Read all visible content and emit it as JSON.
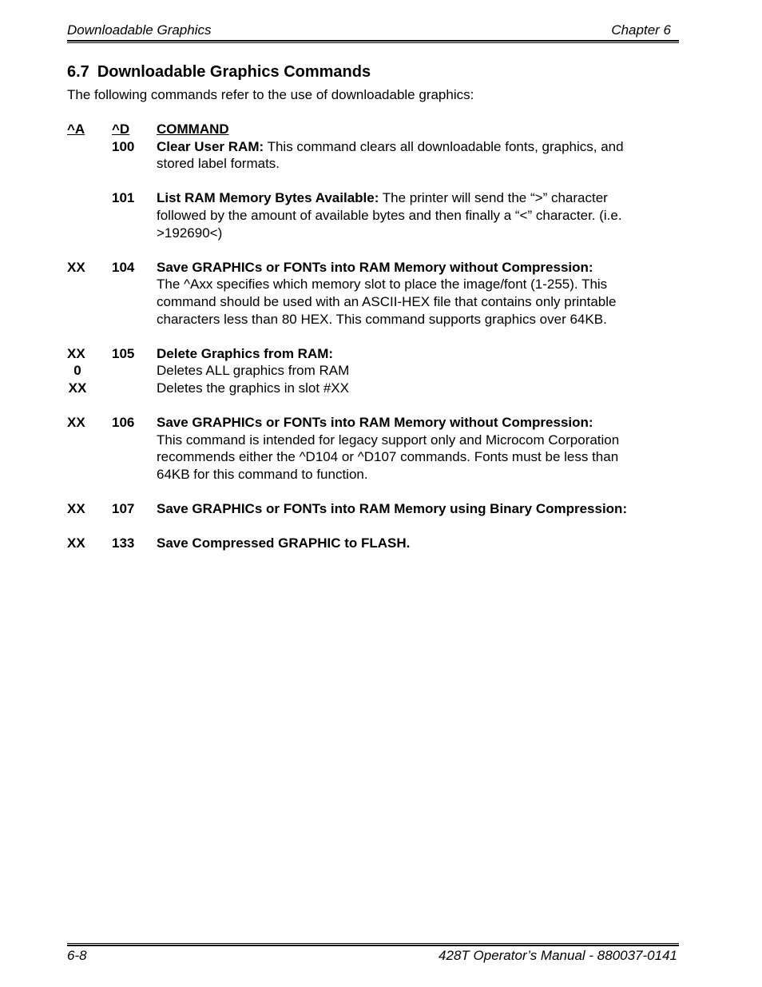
{
  "header": {
    "left": "Downloadable Graphics",
    "right": "Chapter 6"
  },
  "section": {
    "number": "6.7",
    "title": "Downloadable Graphics Commands",
    "intro": "The following commands refer to the use of downloadable graphics:"
  },
  "table": {
    "headers": {
      "a": "^A",
      "d": "^D",
      "command": "COMMAND"
    },
    "entries": [
      {
        "a": "",
        "d": "100",
        "title": "Clear User RAM:",
        "text": " This command clears all downloadable fonts, graphics, and",
        "lines": [
          "stored label formats."
        ]
      },
      {
        "a": "",
        "d": "101",
        "title": "List RAM Memory Bytes Available:",
        "text": " The printer will send the “>” character",
        "lines": [
          "followed by the amount of available bytes and then finally a “<” character.  (i.e.",
          ">192690<)"
        ]
      },
      {
        "a": "XX",
        "d": "104",
        "title": "Save GRAPHICs or FONTs  into RAM Memory without Compression:",
        "text": "",
        "lines": [
          "The ^Axx specifies which memory slot to place the image/font (1-255).  This",
          "command should be used with an ASCII-HEX file that contains only printable",
          "characters less than 80 HEX.  This command supports graphics over 64KB."
        ]
      },
      {
        "a": "XX",
        "d": "105",
        "title": "Delete Graphics from RAM:",
        "text": "",
        "sub": [
          {
            "a": "0",
            "text": "Deletes ALL graphics from RAM"
          },
          {
            "a": "XX",
            "text": "Deletes the graphics in slot #XX"
          }
        ]
      },
      {
        "a": "XX",
        "d": "106",
        "title": "Save GRAPHICs or FONTs into RAM Memory without Compression:",
        "text": "",
        "lines": [
          "This command is intended for legacy support only and Microcom Corporation",
          "recommends either the ^D104 or ^D107 commands.  Fonts must be less than",
          "64KB for this command to function."
        ]
      },
      {
        "a": "XX",
        "d": "107",
        "title": "Save GRAPHICs or FONTs into RAM Memory using Binary Compression:",
        "text": "",
        "lines": []
      },
      {
        "a": "XX",
        "d": "133",
        "title": "Save Compressed GRAPHIC to FLASH.",
        "text": "",
        "lines": []
      }
    ]
  },
  "footer": {
    "left": "6-8",
    "right": "428T Operator’s Manual - 880037-0141"
  }
}
